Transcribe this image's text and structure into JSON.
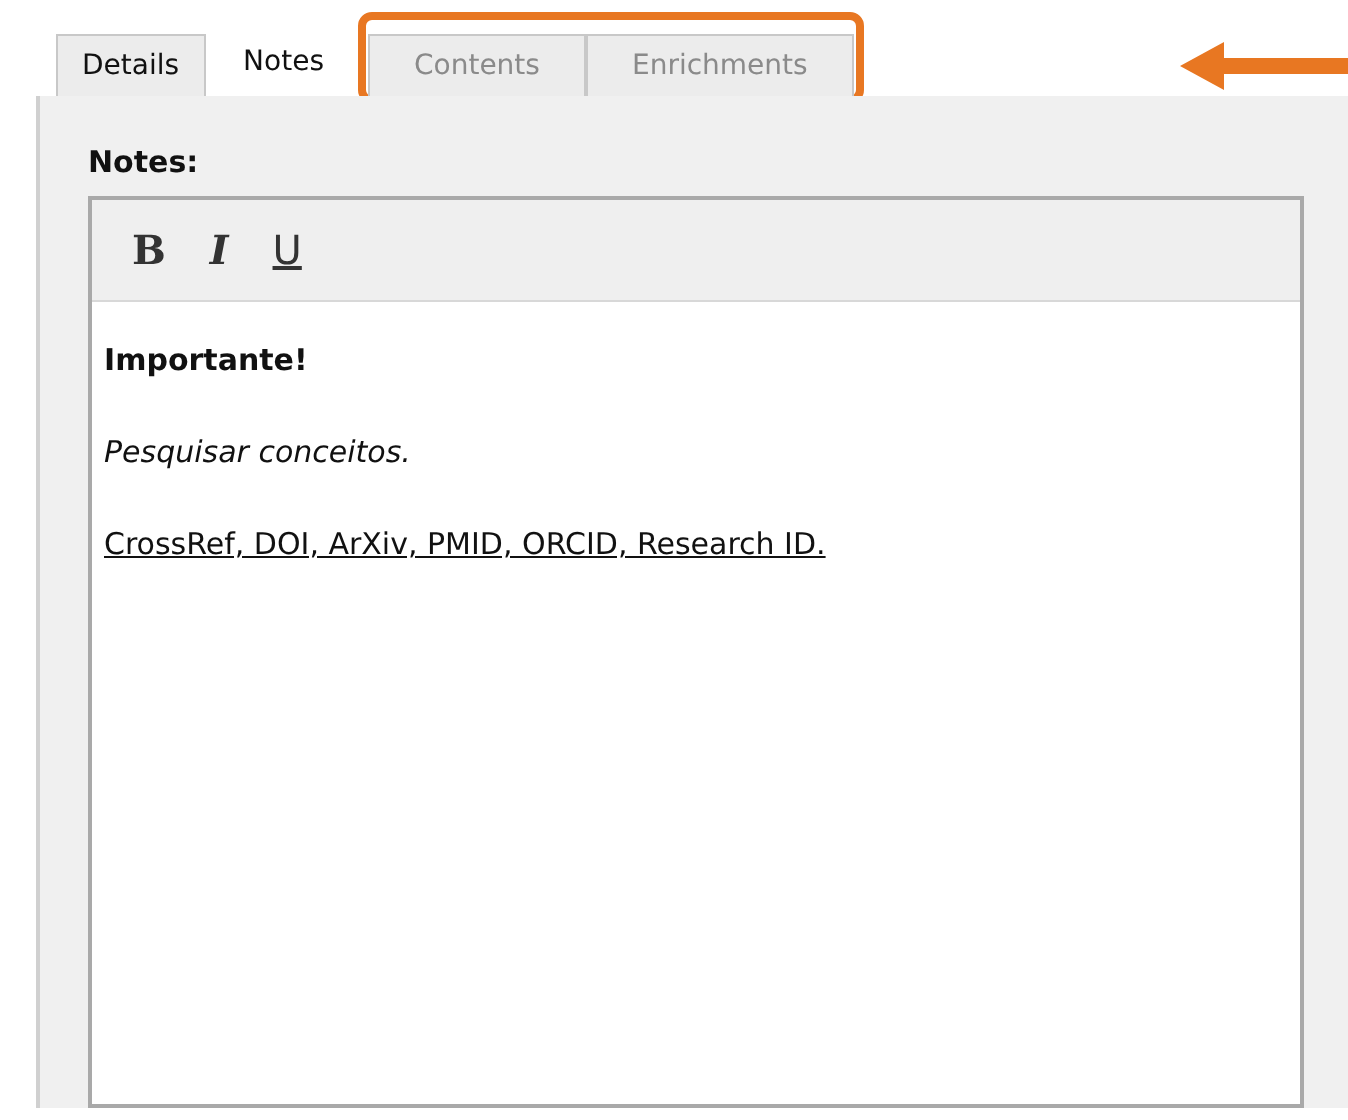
{
  "tabs": [
    {
      "label": "Details",
      "selected": false,
      "highlighted": false
    },
    {
      "label": "Notes",
      "selected": true,
      "highlighted": false
    },
    {
      "label": "Contents",
      "selected": false,
      "highlighted": true
    },
    {
      "label": "Enrichments",
      "selected": false,
      "highlighted": true
    }
  ],
  "notes_label": "Notes:",
  "toolbar": [
    {
      "label": "B",
      "kind": "bold"
    },
    {
      "label": "I",
      "kind": "italic"
    },
    {
      "label": "U",
      "kind": "underline"
    }
  ],
  "paragraphs": [
    {
      "text": "Importante!",
      "kind": "bold"
    },
    {
      "text": "Pesquisar conceitos.",
      "kind": "italic"
    },
    {
      "text": "CrossRef, DOI, ArXiv, PMID, ORCID, Research ID.",
      "kind": "underline"
    }
  ]
}
